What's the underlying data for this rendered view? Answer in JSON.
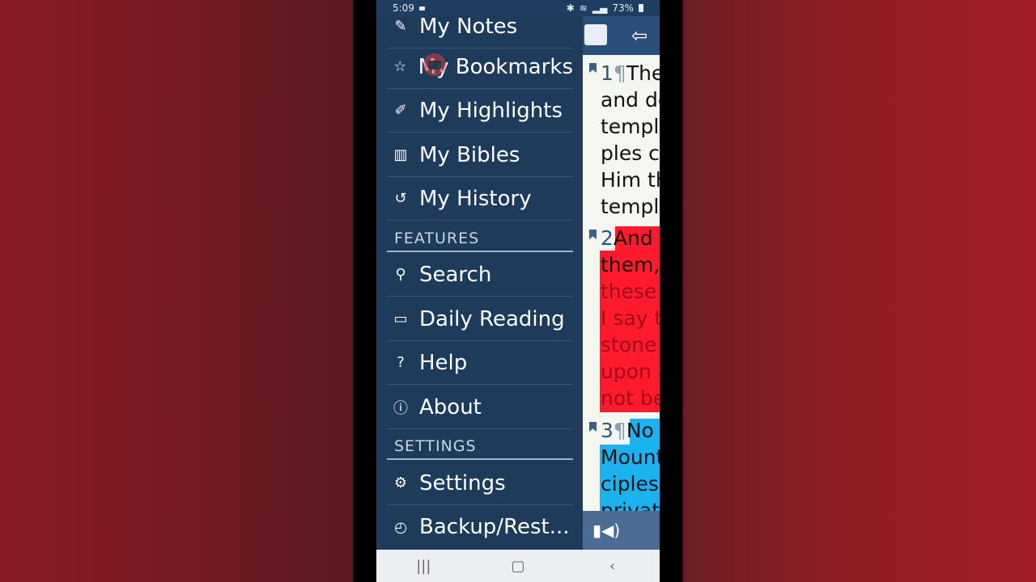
{
  "status": {
    "time": "5:09",
    "battery": "73%"
  },
  "drawer": {
    "items_top": [
      {
        "label": "My Notes",
        "icon": "pen-icon"
      },
      {
        "label": "My Bookmarks",
        "icon": "star-icon"
      },
      {
        "label": "My Highlights",
        "icon": "highlighter-icon"
      },
      {
        "label": "My Bibles",
        "icon": "books-icon"
      },
      {
        "label": "My History",
        "icon": "history-icon"
      }
    ],
    "section_features": "FEATURES",
    "items_features": [
      {
        "label": "Search",
        "icon": "search-icon"
      },
      {
        "label": "Daily Reading",
        "icon": "book-open-icon"
      },
      {
        "label": "Help",
        "icon": "help-icon"
      },
      {
        "label": "About",
        "icon": "info-icon"
      }
    ],
    "section_settings": "SETTINGS",
    "items_settings": [
      {
        "label": "Settings",
        "icon": "gear-icon"
      },
      {
        "label": "Backup/Rest...",
        "icon": "clock-icon"
      }
    ]
  },
  "reader": {
    "verse1": {
      "num": "1",
      "mark": "¶",
      "lines": [
        "The",
        "and de",
        "temple",
        "ples c",
        "Him th",
        "temple"
      ]
    },
    "verse2": {
      "num": "2",
      "lines": [
        "And",
        "them,",
        "these",
        "I say t",
        "stone",
        "upon a",
        "not be"
      ]
    },
    "verse3": {
      "num": "3",
      "mark": "¶",
      "lines": [
        "No",
        "Mount",
        "ciples",
        "privat"
      ]
    }
  },
  "colors": {
    "highlight_red": "#ff1a2e",
    "highlight_blue": "#1ab3f0",
    "drawer_bg": "#1e3b5c"
  }
}
